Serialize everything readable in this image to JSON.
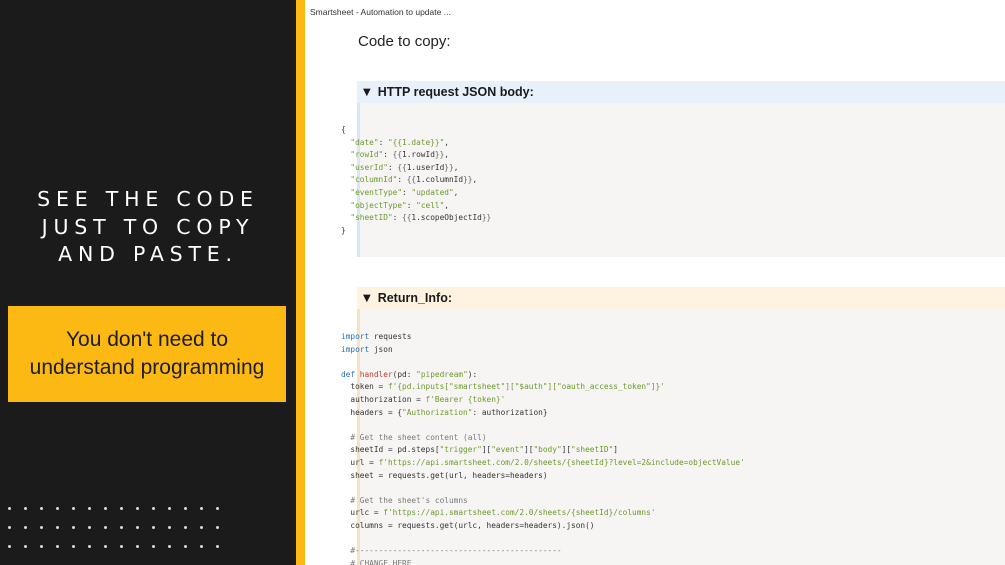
{
  "slide": {
    "headline_lines": [
      "SEE THE CODE",
      "JUST TO COPY",
      "AND PASTE."
    ],
    "callout_text": "You don't need to understand programming",
    "colors": {
      "accent": "#fcb813",
      "background": "#1b1b1b",
      "text": "#ffffff"
    }
  },
  "document": {
    "tab_title": "Smartsheet - Automation to update ...",
    "heading": "Code to copy:",
    "sections": [
      {
        "label": "HTTP request JSON body:",
        "code_lines": [
          "{",
          "  \"date\": \"{{1.date}}\",",
          "  \"rowId\": {{1.rowId}},",
          "  \"userId\": {{1.userId}},",
          "  \"columnId\": {{1.columnId}},",
          "  \"eventType\": \"updated\",",
          "  \"objectType\": \"cell\",",
          "  \"sheetID\": {{1.scopeObjectId}}",
          "}"
        ]
      },
      {
        "label": "Return_Info:",
        "code_lines": [
          "import requests",
          "import json",
          "",
          "def handler(pd: \"pipedream\"):",
          "  token = f'{pd.inputs[\"smartsheet\"][\"$auth\"][\"oauth_access_token\"]}'",
          "  authorization = f'Bearer {token}'",
          "  headers = {\"Authorization\": authorization}",
          "",
          "  # Get the sheet content (all)",
          "  sheetId = pd.steps[\"trigger\"][\"event\"][\"body\"][\"sheetID\"]",
          "  url = f'https://api.smartsheet.com/2.0/sheets/{sheetId}?level=2&include=objectValue'",
          "  sheet = requests.get(url, headers=headers)",
          "",
          "  # Get the sheet's columns",
          "  urlc = f'https://api.smartsheet.com/2.0/sheets/{sheetId}/columns'",
          "  columns = requests.get(urlc, headers=headers).json()",
          "",
          "  #--------------------------------------------",
          "  # CHANGE HERE"
        ]
      }
    ]
  }
}
